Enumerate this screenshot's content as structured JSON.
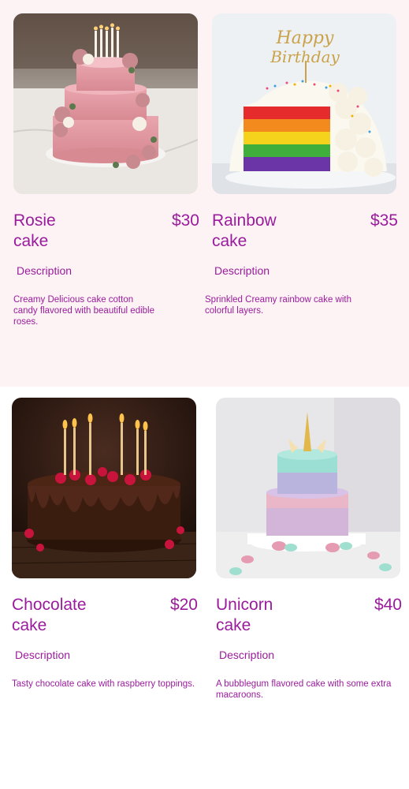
{
  "colors": {
    "accent": "#9a1c9c",
    "top_background": "#fdf3f4",
    "bottom_background": "#ffffff"
  },
  "products": [
    {
      "name": "Rosie\ncake",
      "price": "$30",
      "description_label": "Description",
      "description": "Creamy Delicious cake cotton candy flavored with beautiful edible roses.",
      "image": "rosie-cake-photo"
    },
    {
      "name": "Rainbow\ncake",
      "price": "$35",
      "description_label": "Description",
      "description": "Sprinkled Creamy rainbow cake with colorful layers.",
      "image": "rainbow-cake-photo",
      "topper_text": "Happy Birthday"
    },
    {
      "name": "Chocolate\ncake",
      "price": "$20",
      "description_label": "Description",
      "description": "Tasty chocolate cake with raspberry toppings.",
      "image": "chocolate-cake-photo"
    },
    {
      "name": "Unicorn\ncake",
      "price": "$40",
      "description_label": "Description",
      "description": "A bubblegum flavored cake with some extra macaroons.",
      "image": "unicorn-cake-photo"
    }
  ]
}
